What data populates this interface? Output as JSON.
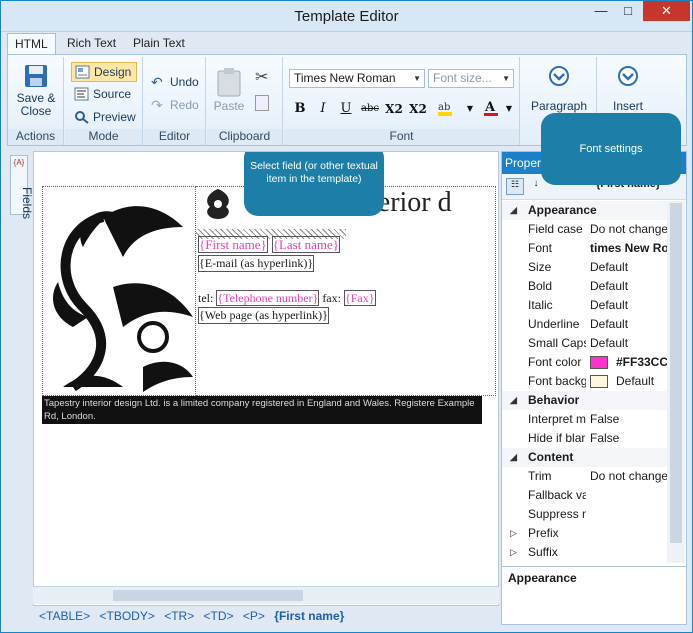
{
  "window": {
    "title": "Template Editor",
    "minimize": "—",
    "maximize": "□",
    "close": "✕"
  },
  "tabs": [
    {
      "label": "HTML",
      "active": true
    },
    {
      "label": "Rich Text",
      "active": false
    },
    {
      "label": "Plain Text",
      "active": false
    }
  ],
  "ribbon": {
    "actions": {
      "save_close": "Save &\nClose",
      "group": "Actions"
    },
    "mode": {
      "design": "Design",
      "source": "Source",
      "preview": "Preview",
      "group": "Mode"
    },
    "editor": {
      "undo": "Undo",
      "redo": "Redo",
      "group": "Editor"
    },
    "clipboard": {
      "paste": "Paste",
      "group": "Clipboard"
    },
    "font": {
      "family": "Times New Roman",
      "size_placeholder": "Font size...",
      "bold": "B",
      "italic": "I",
      "underline": "U",
      "strike": "abc",
      "sub": "X2",
      "sup": "X2",
      "group": "Font"
    },
    "paragraph": {
      "label": "Paragraph"
    },
    "insert": {
      "label": "Insert"
    }
  },
  "fields_tab": {
    "label": "Fields",
    "icon_text": "{A}"
  },
  "document": {
    "heading_fragment": "nterior d",
    "first_name": "{First name}",
    "last_name": "{Last name}",
    "email": "{E-mail (as hyperlink)}",
    "tel_label": "tel:",
    "telephone": "{Telephone number}",
    "fax_label": "fax:",
    "fax": "{Fax}",
    "web": "{Web page (as hyperlink)}",
    "footer": "Tapestry interior design Ltd. is a limited company registered in England and Wales. Registere Example Rd, London."
  },
  "callouts": {
    "select_field": "Select field (or other textual item in the template)",
    "font_settings": "Font settings"
  },
  "statusbar": [
    "<TABLE>",
    "<TBODY>",
    "<TR>",
    "<TD>",
    "<P>",
    "{First name}"
  ],
  "properties": {
    "header": "Propert",
    "selected": "{First name}",
    "rows": [
      {
        "type": "cat",
        "name": "Appearance"
      },
      {
        "name": "Field case",
        "value": "Do not change"
      },
      {
        "name": "Font",
        "value": "times New Ro",
        "bold": true
      },
      {
        "name": "Size",
        "value": "Default"
      },
      {
        "name": "Bold",
        "value": "Default"
      },
      {
        "name": "Italic",
        "value": "Default"
      },
      {
        "name": "Underline",
        "value": "Default"
      },
      {
        "name": "Small Caps",
        "value": "Default"
      },
      {
        "name": "Font color",
        "value": "#FF33CC",
        "bold": true,
        "swatch": "#ff33cc"
      },
      {
        "name": "Font backg",
        "value": "Default",
        "swatch": "#fff6e0"
      },
      {
        "type": "cat",
        "name": "Behavior"
      },
      {
        "name": "Interpret m",
        "value": "False"
      },
      {
        "name": "Hide if blar",
        "value": "False"
      },
      {
        "type": "cat",
        "name": "Content"
      },
      {
        "name": "Trim",
        "value": "Do not change"
      },
      {
        "name": "Fallback va",
        "value": ""
      },
      {
        "name": "Suppress n",
        "value": ""
      },
      {
        "type": "sub",
        "name": "Prefix"
      },
      {
        "type": "sub",
        "name": "Suffix"
      }
    ],
    "description": "Appearance"
  },
  "colors": {
    "accent": "#1c7fc9",
    "field": "#e540b4",
    "callout": "#1d7fa8"
  }
}
